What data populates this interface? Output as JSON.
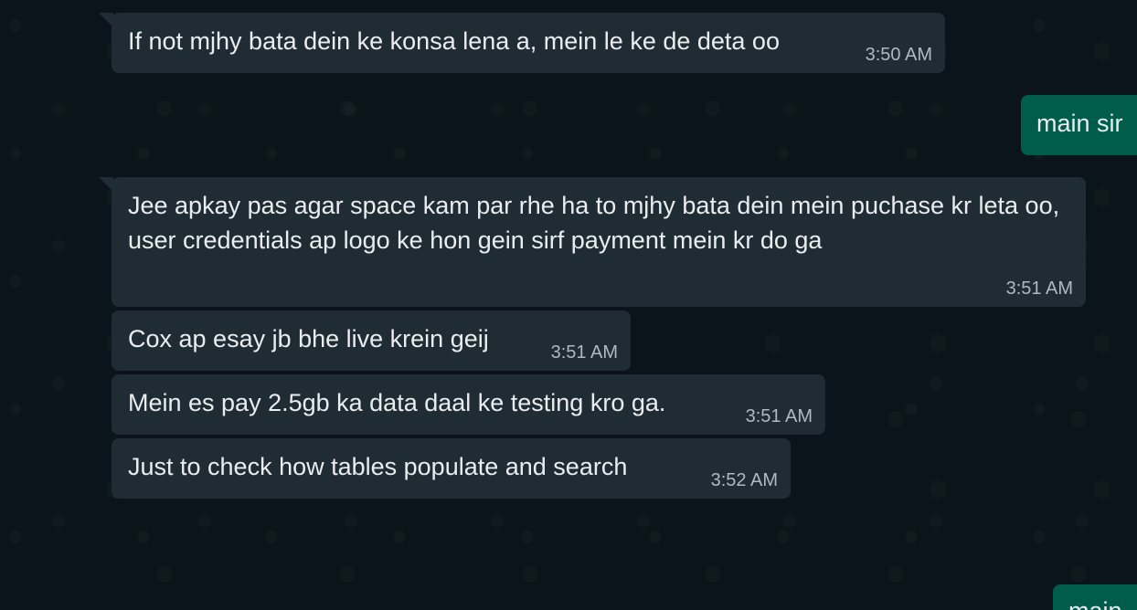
{
  "conversation": {
    "messages": [
      {
        "direction": "incoming",
        "text": "If not mjhy bata dein ke konsa lena a, mein le ke de deta oo",
        "time": "3:50 AM"
      },
      {
        "direction": "outgoing",
        "text": "main sir",
        "time": ""
      },
      {
        "direction": "incoming",
        "text": "Jee apkay pas agar space kam par rhe ha to mjhy bata dein mein puchase kr leta oo, user credentials ap logo ke hon gein sirf payment mein kr do ga",
        "time": "3:51 AM"
      },
      {
        "direction": "incoming",
        "text": "Cox ap esay jb bhe live krein geij",
        "time": "3:51 AM"
      },
      {
        "direction": "incoming",
        "text": "Mein es pay 2.5gb ka data daal ke testing kro ga.",
        "time": "3:51 AM"
      },
      {
        "direction": "incoming",
        "text": "Just to check how tables populate and search",
        "time": "3:52 AM"
      },
      {
        "direction": "outgoing",
        "text": "main",
        "time": ""
      }
    ]
  },
  "colors": {
    "background": "#0b141a",
    "incoming_bubble": "#202c33",
    "outgoing_bubble": "#005c4b",
    "message_text": "#e9edef",
    "timestamp_text": "#aebac1"
  }
}
